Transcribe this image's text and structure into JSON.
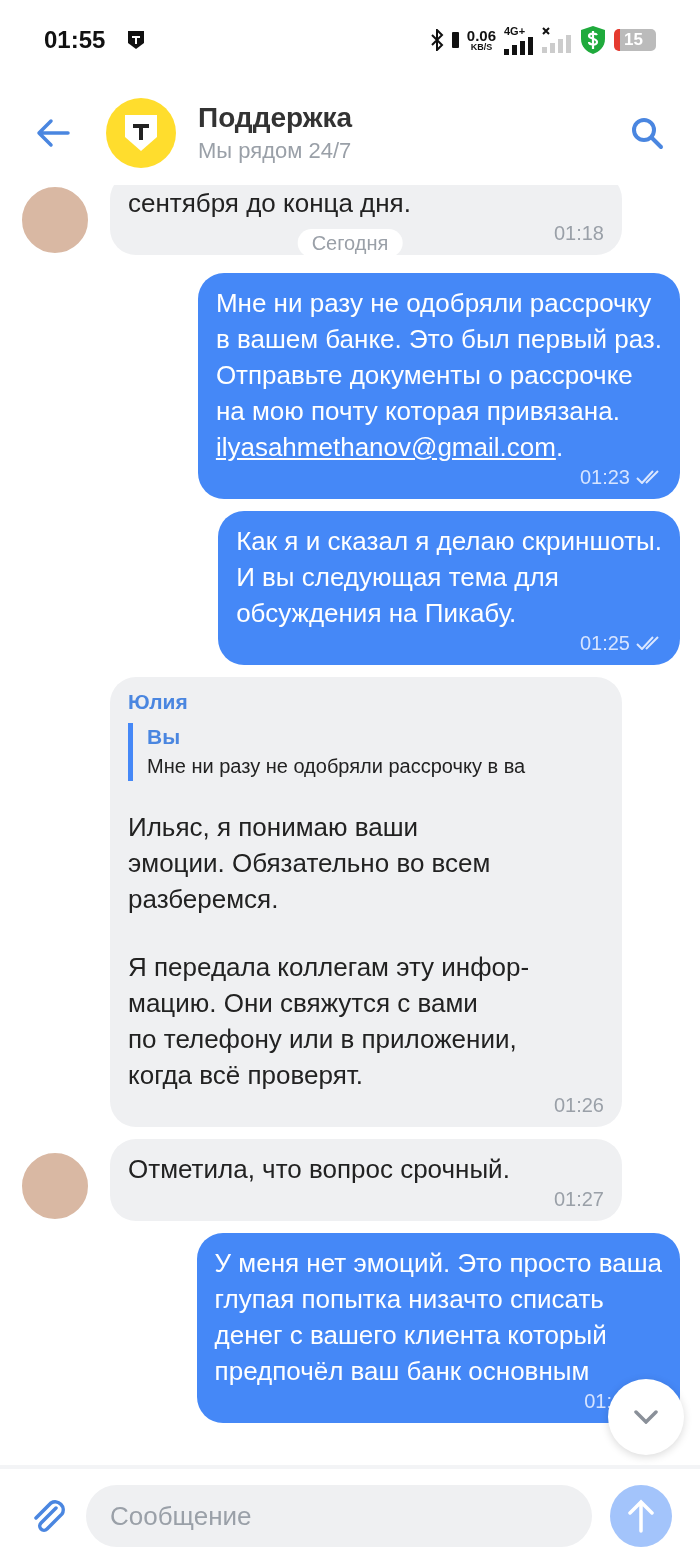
{
  "status_bar": {
    "time": "01:55",
    "speed": "0.06",
    "speed_unit": "KB/S",
    "network": "4G+",
    "battery": "15"
  },
  "header": {
    "title": "Поддержка",
    "subtitle": "Мы рядом 24/7"
  },
  "date_chip": "Сегодня",
  "messages": [
    {
      "kind": "incoming",
      "avatar": true,
      "paragraphs": [
        "сентября до конца дня."
      ],
      "time": "01:18"
    },
    {
      "kind": "outgoing",
      "paragraphs": [
        "Мне ни разу не одобряли рассрочку\nв вашем банке. Это был первый раз.\nОтправьте документы о рассрочке\nна мою почту которая привязана."
      ],
      "link": "ilyasahmethanov@gmail.com",
      "link_suffix": ".",
      "time": "01:23",
      "read": true
    },
    {
      "kind": "outgoing",
      "paragraphs": [
        "Как я и сказал я делаю скриншоты.\nИ вы следующая тема для\nобсуждения на Пикабу."
      ],
      "time": "01:25",
      "read": true
    },
    {
      "kind": "incoming",
      "avatar": false,
      "sender": "Юлия",
      "reply": {
        "sender": "Вы",
        "text": "Мне ни разу не одобряли рассрочку в ва"
      },
      "paragraphs": [
        "Ильяс, я понимаю ваши\nэмоции. Обязательно во всем\nразберемся.",
        "Я передала коллегам эту инфор-\nмацию. Они свяжутся с вами\nпо телефону или в приложении,\nкогда всё проверят."
      ],
      "time": "01:26"
    },
    {
      "kind": "incoming",
      "avatar": true,
      "paragraphs": [
        "Отметила, что вопрос срочный."
      ],
      "time": "01:27"
    },
    {
      "kind": "outgoing",
      "paragraphs": [
        "У меня нет эмоций. Это просто ваша\nглупая попытка низачто списать\nденег с вашего клиента который\nпредпочёл ваш банк основным"
      ],
      "time": "01:"
    }
  ],
  "composer": {
    "placeholder": "Сообщение"
  }
}
